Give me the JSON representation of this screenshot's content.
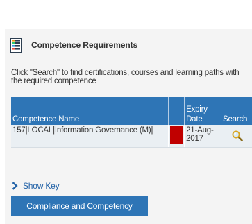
{
  "panel": {
    "title": "Competence Requirements",
    "icon": "report-list-icon",
    "instructions": "Click \"Search\" to find certifications, courses and learning paths with the required competence"
  },
  "table": {
    "headers": {
      "name": "Competence Name",
      "status": "",
      "expiry": "Expiry Date",
      "search": "Search"
    },
    "rows": [
      {
        "name": "157|LOCAL|Information Governance (M)|",
        "status_color": "#c00000",
        "expiry": "21-Aug-2017",
        "search_icon": "magnifier-icon"
      }
    ]
  },
  "show_key": {
    "label": "Show Key",
    "icon": "chevron-right-icon"
  },
  "compliance_button": {
    "label": "Compliance and Competency"
  },
  "colors": {
    "header_blue": "#2e75b6",
    "link_blue": "#2262a7",
    "panel_background": "#f4f4f4",
    "status_red": "#c00000"
  }
}
